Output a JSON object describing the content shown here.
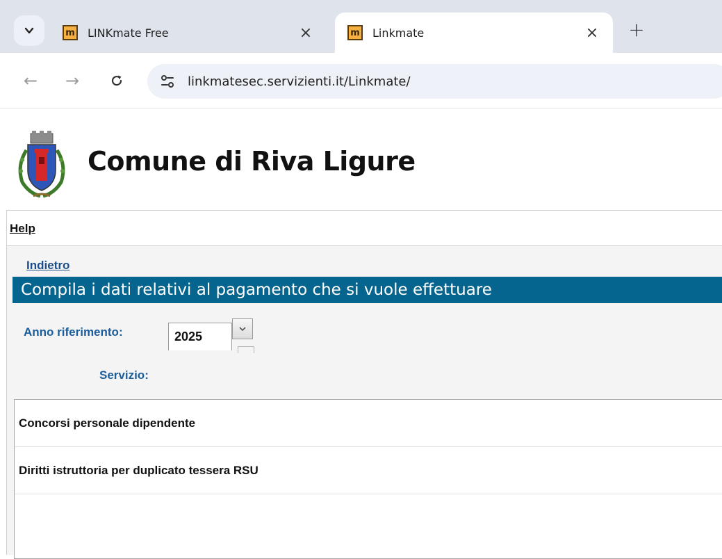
{
  "browser": {
    "tabs": [
      {
        "title": "LINKmate Free",
        "favicon": "m"
      },
      {
        "title": "Linkmate",
        "favicon": "m"
      }
    ],
    "url": "linkmatesec.servizienti.it/Linkmate/",
    "icons": {
      "tab_menu": "chevron-down-icon",
      "close": "×",
      "new_tab": "+",
      "back": "←",
      "forward": "→",
      "reload": "C",
      "site_settings": "tune-icon"
    }
  },
  "header": {
    "title": "Comune di Riva Ligure"
  },
  "menu": {
    "help": "Help"
  },
  "form": {
    "back_link": "Indietro",
    "section_title": "Compila i dati relativi al pagamento che si vuole effettuare",
    "year_label": "Anno riferimento:",
    "year_value": "2025",
    "service_label": "Servizio:",
    "services": [
      "Concorsi personale dipendente",
      "Diritti istruttoria per duplicato tessera RSU"
    ]
  },
  "colors": {
    "section_bar": "#05658f",
    "label_blue": "#1b5e9c",
    "link_blue": "#1b4e8a",
    "tabstrip": "#dfe3ec"
  }
}
